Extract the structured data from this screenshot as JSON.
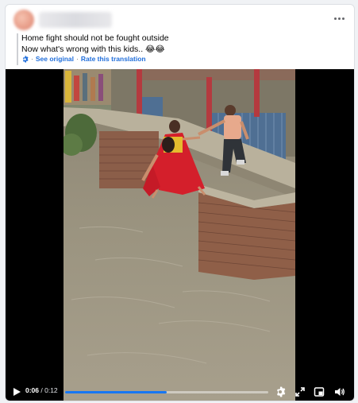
{
  "post": {
    "line1": "Home fight should not be fought outside",
    "line2": "Now what's wrong with this kids.. 😂😂",
    "see_original": "See original",
    "separator": "·",
    "rate_translation": "Rate this translation"
  },
  "video": {
    "current_time": "0:06",
    "time_separator": " / ",
    "duration": "0:12",
    "progress_fraction": 0.5
  },
  "icons": {
    "more": "more-options-icon",
    "translate": "gear-icon",
    "play": "play-icon",
    "settings": "gear-icon",
    "fullscreen": "expand-icon",
    "pip": "picture-in-picture-icon",
    "volume": "volume-icon"
  },
  "colors": {
    "link": "#216fdb",
    "progress": "#1877f2"
  }
}
